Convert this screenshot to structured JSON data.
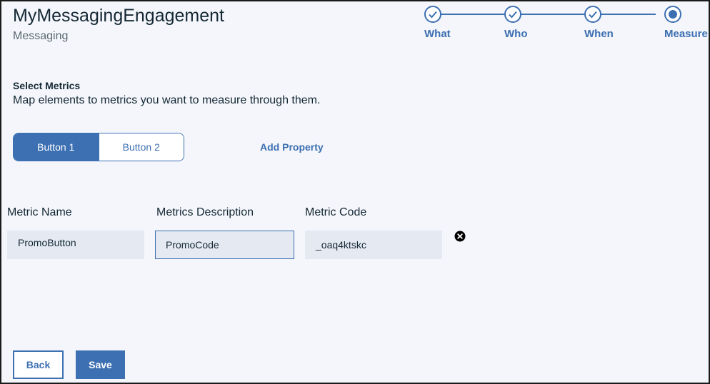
{
  "header": {
    "title": "MyMessagingEngagement",
    "subtitle": "Messaging"
  },
  "stepper": {
    "steps": [
      {
        "label": "What",
        "state": "complete",
        "icon": "checkmark-icon"
      },
      {
        "label": "Who",
        "state": "complete",
        "icon": "checkmark-icon"
      },
      {
        "label": "When",
        "state": "complete",
        "icon": "checkmark-icon"
      },
      {
        "label": "Measure",
        "state": "current",
        "icon": "current-step-icon"
      }
    ],
    "accent_color": "#3d70b2"
  },
  "section": {
    "title": "Select Metrics",
    "description": "Map elements to metrics you want to measure through them."
  },
  "segmented": {
    "buttons": [
      {
        "label": "Button 1",
        "selected": true
      },
      {
        "label": "Button 2",
        "selected": false
      }
    ]
  },
  "add_property_label": "Add Property",
  "fields": {
    "metric_name": {
      "label": "Metric Name",
      "value": "PromoButton"
    },
    "metrics_description": {
      "label": "Metrics Description",
      "value": "PromoCode"
    },
    "metric_code": {
      "label": "Metric Code",
      "value": "_oaq4ktskc"
    }
  },
  "remove_icon": "close-circle-icon",
  "actions": {
    "back_label": "Back",
    "save_label": "Save"
  }
}
